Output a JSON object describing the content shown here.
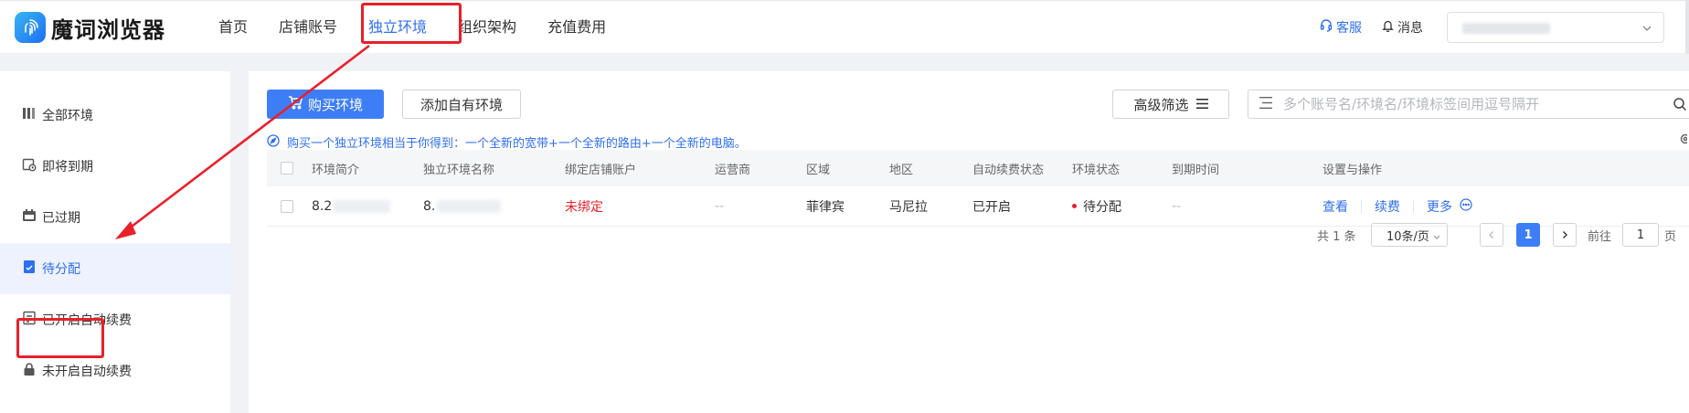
{
  "header": {
    "brand": "魔词浏览器",
    "nav": [
      "首页",
      "店铺账号",
      "独立环境",
      "组织架构",
      "充值费用"
    ],
    "service_label": "客服",
    "message_label": "消息"
  },
  "sidebar": {
    "items": [
      {
        "label": "全部环境",
        "icon": "all-grid-icon"
      },
      {
        "label": "即将到期",
        "icon": "clock-calendar-icon"
      },
      {
        "label": "已过期",
        "icon": "calendar-icon"
      },
      {
        "label": "待分配",
        "icon": "assign-doc-icon"
      },
      {
        "label": "已开启自动续费",
        "icon": "renew-doc-icon"
      },
      {
        "label": "未开启自动续费",
        "icon": "lock-icon"
      }
    ]
  },
  "toolbar": {
    "buy_label": "购买环境",
    "add_own_label": "添加自有环境",
    "filter_label": "高级筛选",
    "search_placeholder": "多个账号名/环境名/环境标签间用逗号隔开"
  },
  "tip": "购买一个独立环境相当于你得到：一个全新的宽带+一个全新的路由+一个全新的电脑。",
  "table": {
    "columns": [
      "环境简介",
      "独立环境名称",
      "绑定店铺账户",
      "运营商",
      "区域",
      "地区",
      "自动续费状态",
      "环境状态",
      "到期时间",
      "设置与操作"
    ],
    "rows": [
      {
        "intro": "8.2",
        "name": "8.",
        "shop": "未绑定",
        "carrier": "--",
        "region": "菲律宾",
        "area": "马尼拉",
        "auto_renew": "已开启",
        "status": "待分配",
        "expire": "--",
        "actions": [
          "查看",
          "续费",
          "更多"
        ]
      }
    ]
  },
  "pagination": {
    "total": "共 1 条",
    "page_size": "10条/页",
    "current": "1",
    "goto_label": "前往",
    "goto_value": "1",
    "page_suffix": "页"
  },
  "colors": {
    "accent": "#3d7ef7",
    "annotation": "#e8202a"
  }
}
